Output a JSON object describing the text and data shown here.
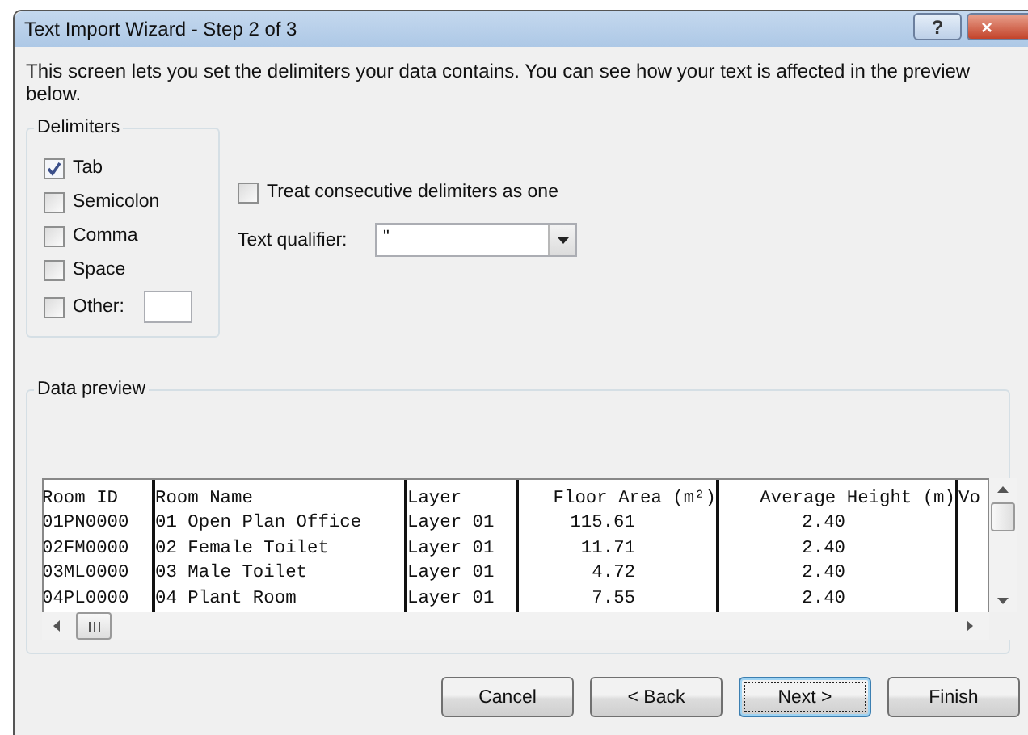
{
  "window": {
    "title": "Text Import Wizard - Step 2 of 3",
    "help_button": "?",
    "close_button": "×"
  },
  "description": "This screen lets you set the delimiters your data contains.  You can see how your text is affected in the preview below.",
  "delimiters": {
    "title": "Delimiters",
    "options": [
      {
        "label": "Tab",
        "checked": true
      },
      {
        "label": "Semicolon",
        "checked": false
      },
      {
        "label": "Comma",
        "checked": false
      },
      {
        "label": "Space",
        "checked": false
      },
      {
        "label": "Other:",
        "checked": false,
        "field": true
      }
    ]
  },
  "treat_consecutive": {
    "label": "Treat consecutive delimiters as one",
    "checked": false
  },
  "text_qualifier": {
    "label": "Text qualifier:",
    "value": "\""
  },
  "data_preview": {
    "title": "Data preview",
    "columns": [
      {
        "label": "Room ID",
        "kind": "text"
      },
      {
        "label": "Room Name",
        "kind": "text"
      },
      {
        "label": "Layer",
        "kind": "text"
      },
      {
        "label": "Floor Area (m²)",
        "kind": "number"
      },
      {
        "label": "Average Height (m)",
        "kind": "number"
      },
      {
        "label": "Vo",
        "kind": "text"
      }
    ],
    "rows": [
      [
        "01PN0000",
        "01 Open Plan Office",
        "Layer 01",
        "115.61",
        "2.40"
      ],
      [
        "02FM0000",
        "02 Female Toilet",
        "Layer 01",
        "11.71",
        "2.40"
      ],
      [
        "03ML0000",
        "03 Male Toilet",
        "Layer 01",
        "4.72",
        "2.40"
      ],
      [
        "04PL0000",
        "04 Plant Room",
        "Layer 01",
        "7.55",
        "2.40"
      ]
    ]
  },
  "buttons": [
    {
      "label": "Cancel",
      "default": false
    },
    {
      "label": "< Back",
      "default": false
    },
    {
      "label": "Next >",
      "default": true
    },
    {
      "label": "Finish",
      "default": false
    }
  ]
}
